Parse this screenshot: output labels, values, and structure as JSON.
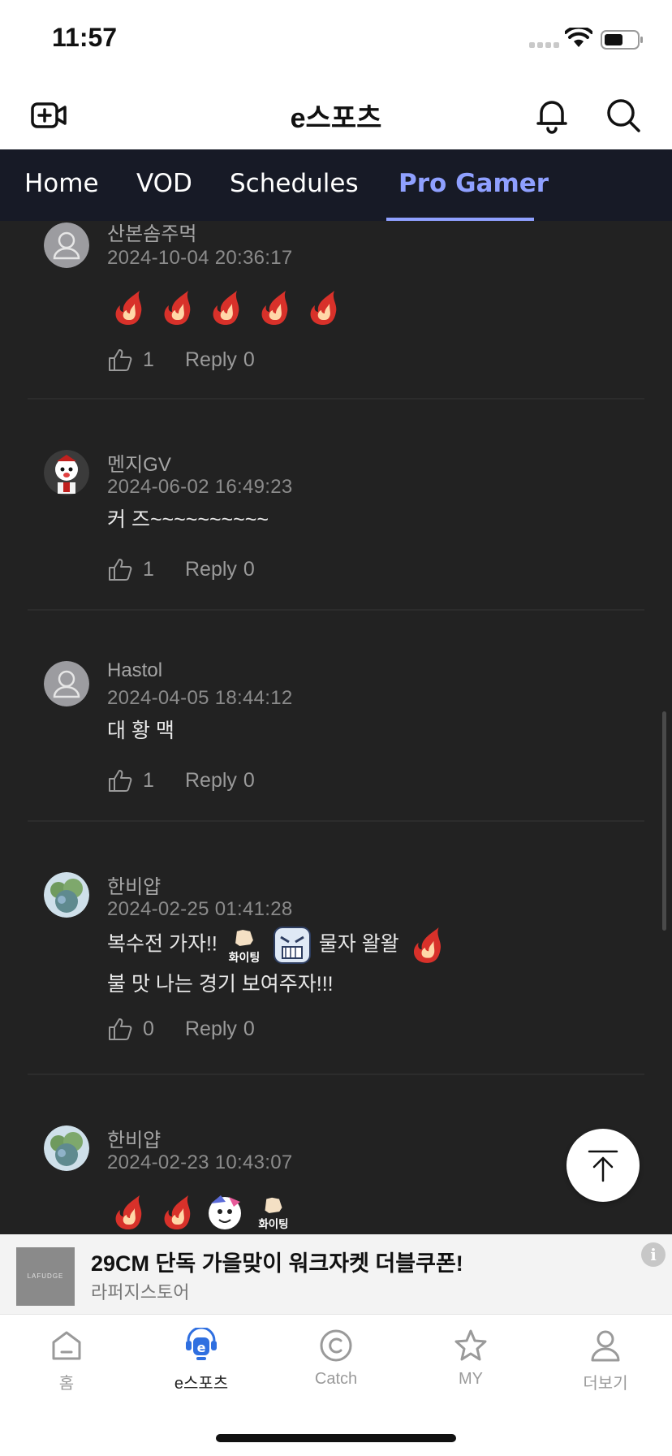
{
  "status_bar": {
    "time": "11:57"
  },
  "header": {
    "title": "e스포츠"
  },
  "tabs": [
    {
      "label": "Home"
    },
    {
      "label": "VOD"
    },
    {
      "label": "Schedules"
    },
    {
      "label": "Pro Gamer",
      "active": true
    }
  ],
  "comments": [
    {
      "username": "산본솜주먹",
      "date": "2024-10-04 20:36:17",
      "text": "",
      "emojis": [
        "fire-emoji",
        "fire-emoji",
        "fire-emoji",
        "fire-emoji",
        "fire-emoji"
      ],
      "likes": "1",
      "reply_label": "Reply",
      "replies": "0",
      "avatar": "default-avatar"
    },
    {
      "username": "멘지GV",
      "date": "2024-06-02 16:49:23",
      "text": "커 즈~~~~~~~~~~",
      "likes": "1",
      "reply_label": "Reply",
      "replies": "0",
      "avatar": "character-avatar"
    },
    {
      "username": "Hastol",
      "date": "2024-04-05 18:44:12",
      "text": "대 황 맥",
      "likes": "1",
      "reply_label": "Reply",
      "replies": "0",
      "avatar": "default-avatar"
    },
    {
      "username": "한비얍",
      "date": "2024-02-25 01:41:28",
      "text_part1": "복수전 가자!!",
      "emoji_label": "화이팅",
      "text_part2": "물자 왈왈",
      "text_line2": "불 맛 나는 경기 보여주자!!!",
      "likes": "0",
      "reply_label": "Reply",
      "replies": "0",
      "avatar": "landscape-avatar"
    },
    {
      "username": "한비얍",
      "date": "2024-02-23 10:43:07",
      "emoji_label": "화이팅",
      "emojis": [
        "fire-emoji",
        "fire-emoji",
        "character-emoji",
        "fighting-emoji"
      ],
      "avatar": "landscape-avatar"
    }
  ],
  "ad": {
    "logo_text": "LAFUDGE",
    "title": "29CM 단독 가을맞이 워크자켓 더블쿠폰!",
    "subtitle": "라퍼지스토어",
    "info": "i"
  },
  "bottom_nav": [
    {
      "label": "홈",
      "icon": "home-icon"
    },
    {
      "label": "e스포츠",
      "icon": "esports-icon",
      "active": true
    },
    {
      "label": "Catch",
      "icon": "catch-icon"
    },
    {
      "label": "MY",
      "icon": "star-icon"
    },
    {
      "label": "더보기",
      "icon": "person-icon"
    }
  ],
  "colors": {
    "accent": "#8fa0ff",
    "tab_bg": "#171a26",
    "content_bg": "#222222",
    "nav_active": "#2f6fe0"
  }
}
